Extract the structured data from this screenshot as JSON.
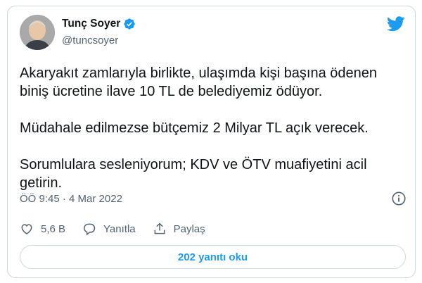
{
  "author": {
    "display_name": "Tunç Soyer",
    "handle": "@tuncsoyer"
  },
  "tweet": {
    "paragraphs": [
      "Akaryakıt zamlarıyla birlikte, ulaşımda kişi başına ödenen biniş ücretine ilave 10 TL de belediyemiz ödüyor.",
      "Müdahale edilmezse bütçemiz 2 Milyar TL açık verecek.",
      "Sorumlulara sesleniyorum; KDV ve ÖTV muafiyetini acil getirin."
    ],
    "timestamp": "ÖÖ 9:45 · 4 Mar 2022"
  },
  "actions": {
    "like_count": "5,6 B",
    "reply_label": "Yanıtla",
    "share_label": "Paylaş"
  },
  "read_replies_label": "202 yanıtı oku",
  "colors": {
    "brand_blue": "#1d9bf0",
    "text_primary": "#0f1419",
    "text_secondary": "#536471",
    "border": "#cfd9de"
  },
  "icons": [
    "verified-badge-icon",
    "twitter-bird-icon",
    "info-icon",
    "heart-icon",
    "reply-icon",
    "share-icon"
  ]
}
